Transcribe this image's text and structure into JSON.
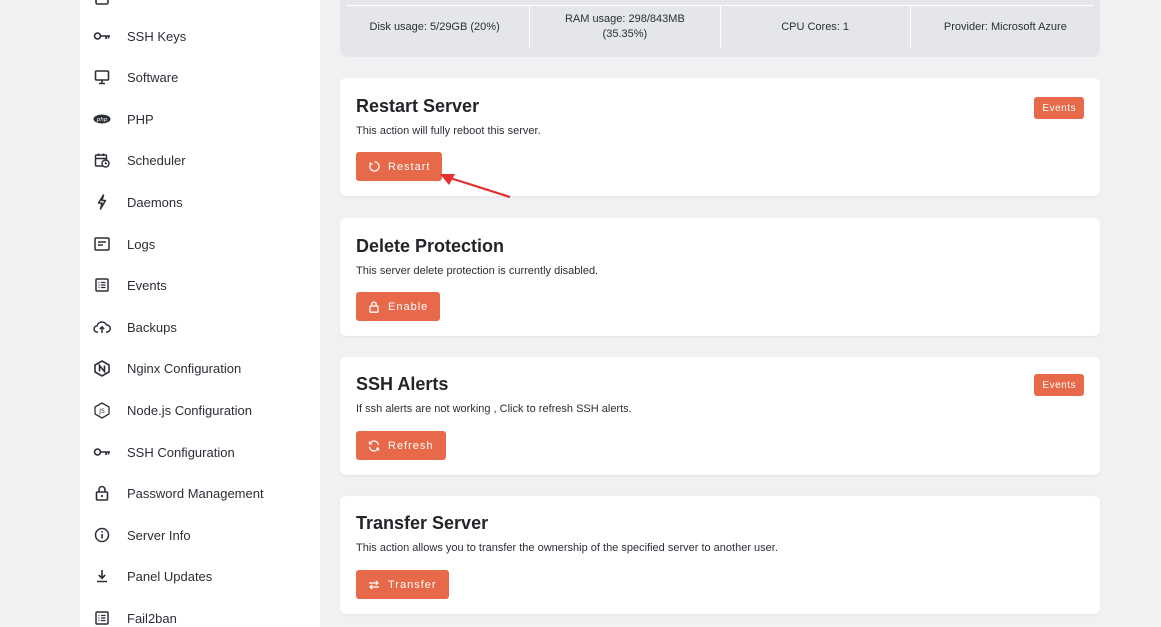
{
  "sidebar": {
    "items": [
      {
        "label": "SSH Keys",
        "icon": "key-icon"
      },
      {
        "label": "Software",
        "icon": "monitor-icon"
      },
      {
        "label": "PHP",
        "icon": "php-icon"
      },
      {
        "label": "Scheduler",
        "icon": "calendar-clock-icon"
      },
      {
        "label": "Daemons",
        "icon": "bolt-icon"
      },
      {
        "label": "Logs",
        "icon": "logs-icon"
      },
      {
        "label": "Events",
        "icon": "list-icon"
      },
      {
        "label": "Backups",
        "icon": "cloud-upload-icon"
      },
      {
        "label": "Nginx Configuration",
        "icon": "nginx-icon"
      },
      {
        "label": "Node.js Configuration",
        "icon": "nodejs-icon"
      },
      {
        "label": "SSH Configuration",
        "icon": "key-icon"
      },
      {
        "label": "Password Management",
        "icon": "lock-icon"
      },
      {
        "label": "Server Info",
        "icon": "info-icon"
      },
      {
        "label": "Panel Updates",
        "icon": "download-icon"
      },
      {
        "label": "Fail2ban",
        "icon": "list-icon"
      }
    ]
  },
  "stats": {
    "disk": "Disk usage: 5/29GB (20%)",
    "ram": "RAM usage: 298/843MB (35.35%)",
    "cpu": "CPU Cores: 1",
    "provider_label": "Provider:",
    "provider_value": "Microsoft Azure"
  },
  "cards": {
    "restart": {
      "title": "Restart Server",
      "desc": "This action will fully reboot this server.",
      "badge": "Events",
      "button": "Restart"
    },
    "delete_protection": {
      "title": "Delete Protection",
      "desc": "This server delete protection is currently disabled.",
      "button": "Enable"
    },
    "ssh_alerts": {
      "title": "SSH Alerts",
      "desc": "If ssh alerts are not working , Click to refresh SSH alerts.",
      "badge": "Events",
      "button": "Refresh"
    },
    "transfer": {
      "title": "Transfer Server",
      "desc": "This action allows you to transfer the ownership of the specified server to another user.",
      "button": "Transfer"
    }
  },
  "colors": {
    "accent": "#e8694a",
    "annotation_arrow": "#e03030"
  }
}
